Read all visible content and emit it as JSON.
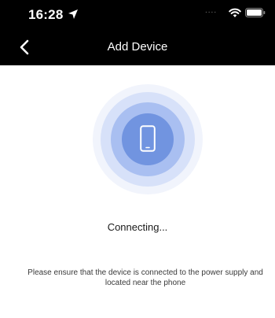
{
  "status_bar": {
    "time": "16:28",
    "signal_dots": "....",
    "icons": [
      "location-arrow-icon",
      "wifi-icon",
      "battery-icon"
    ]
  },
  "nav": {
    "title": "Add Device",
    "back_icon": "chevron-left-icon"
  },
  "main": {
    "animation_icon": "phone-icon",
    "status": "Connecting...",
    "hint": "Please ensure that the device is connected to the power supply and located near the phone"
  },
  "colors": {
    "topbar_bg": "#000000",
    "pulse_outer": "#f1f4fc",
    "pulse_mid1": "#d7e1f9",
    "pulse_mid2": "#a9bff1",
    "pulse_inner": "#7194e0",
    "text": "#1a1a1a"
  }
}
